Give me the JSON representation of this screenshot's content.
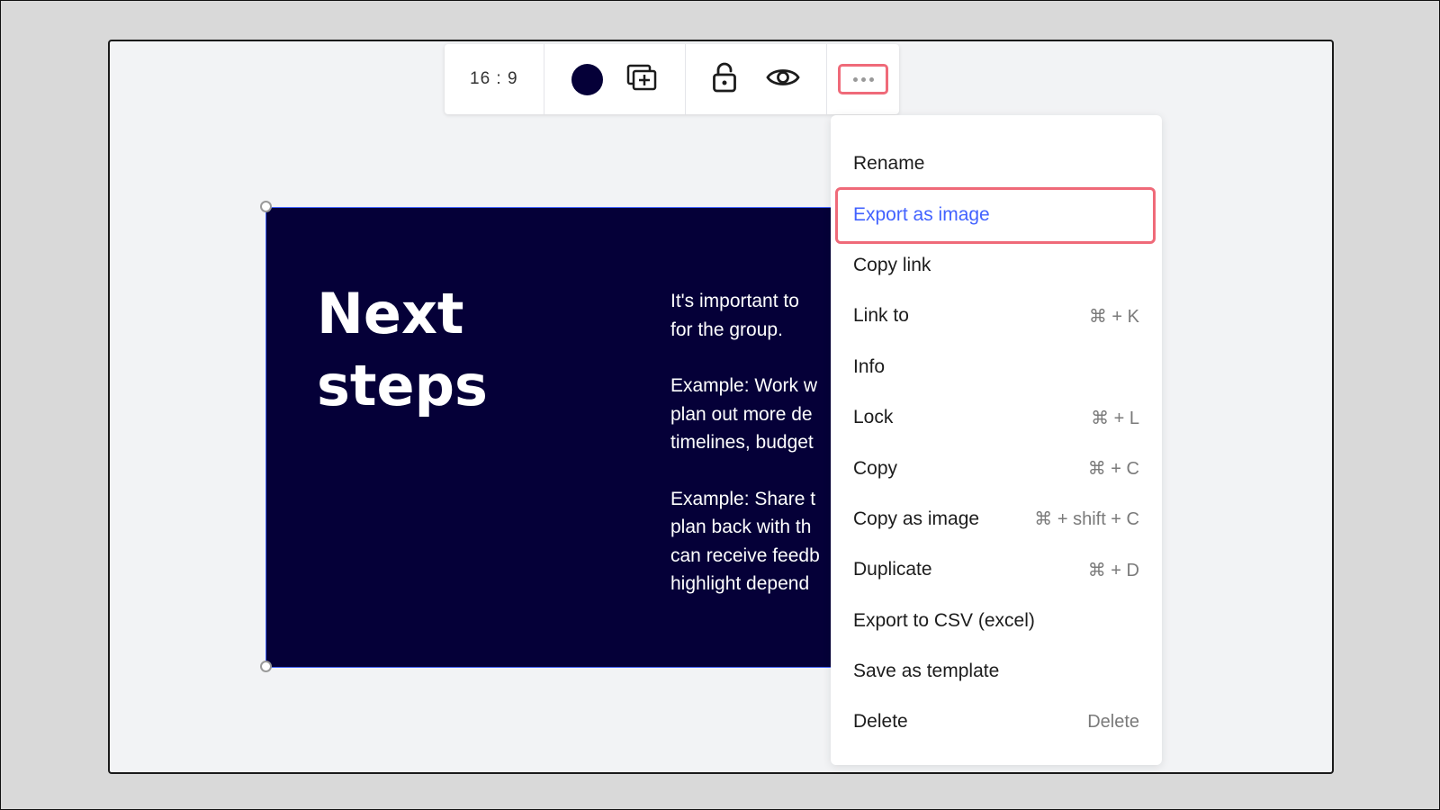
{
  "toolbar": {
    "aspect_ratio": "16 : 9",
    "color_value": "#050038",
    "icons": [
      "color-swatch",
      "add-frame-icon",
      "unlock-icon",
      "eye-icon",
      "more-options-icon"
    ]
  },
  "slide": {
    "title_line1": "Next",
    "title_line2": "steps",
    "paragraphs": [
      [
        "It's important to",
        "for the group."
      ],
      [
        "Example: Work w",
        "plan out more de",
        "timelines, budget"
      ],
      [
        "Example: Share t",
        "plan back with th",
        "can receive feedb",
        "highlight depend"
      ]
    ],
    "background": "#050038"
  },
  "menu": {
    "items": [
      {
        "label": "Rename",
        "shortcut": ""
      },
      {
        "label": "Export as image",
        "shortcut": "",
        "highlighted": true
      },
      {
        "label": "Copy link",
        "shortcut": ""
      },
      {
        "label": "Link to",
        "shortcut": "⌘ + K"
      },
      {
        "label": "Info",
        "shortcut": ""
      },
      {
        "label": "Lock",
        "shortcut": "⌘ + L"
      },
      {
        "label": "Copy",
        "shortcut": "⌘ + C"
      },
      {
        "label": "Copy as image",
        "shortcut": "⌘ + shift + C"
      },
      {
        "label": "Duplicate",
        "shortcut": "⌘ + D"
      },
      {
        "label": "Export to CSV (excel)",
        "shortcut": ""
      },
      {
        "label": "Save as template",
        "shortcut": ""
      },
      {
        "label": "Delete",
        "shortcut": "Delete"
      }
    ]
  },
  "colors": {
    "accent": "#4262ff",
    "highlight_border": "#ef6a79",
    "slide_bg": "#050038"
  }
}
